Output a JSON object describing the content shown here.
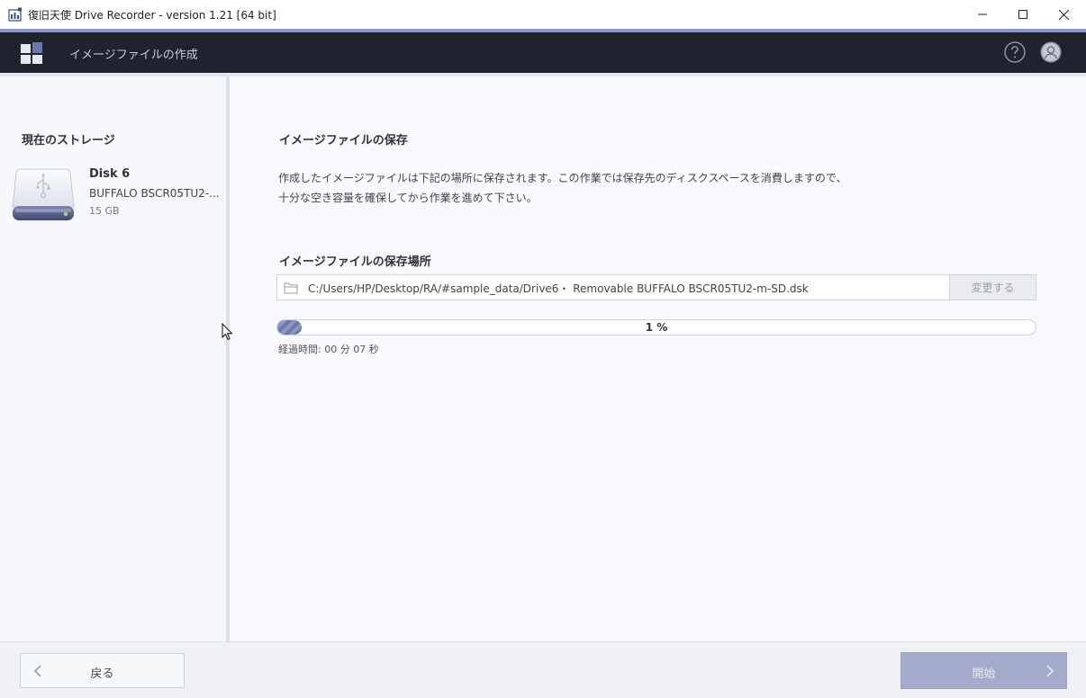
{
  "window": {
    "title": "復旧天使 Drive Recorder - version 1.21 [64 bit]"
  },
  "header": {
    "title": "イメージファイルの作成"
  },
  "sidebar": {
    "heading": "現在のストレージ",
    "disk": {
      "name": "Disk 6",
      "model": "BUFFALO BSCR05TU2-...",
      "size": "15 GB"
    }
  },
  "main": {
    "save_section_title": "イメージファイルの保存",
    "description_line1": "作成したイメージファイルは下記の場所に保存されます。この作業では保存先のディスクスペースを消費しますので、",
    "description_line2": "十分な空き容量を確保してから作業を進めて下さい。",
    "location_title": "イメージファイルの保存場所",
    "path": "C:/Users/HP/Desktop/RA/#sample_data/Drive6・ Removable BUFFALO BSCR05TU2-m-SD.dsk",
    "change_label": "変更する",
    "progress_percent": 1,
    "progress_label": "1 %",
    "elapsed": "経過時間: 00 分 07 秒"
  },
  "footer": {
    "back_label": "戻る",
    "start_label": "開始"
  },
  "colors": {
    "accent": "#8c95c9",
    "header_bg": "#20232e",
    "start_button": "#a5abcb",
    "progress_fill": "#6d78a8"
  },
  "icons": {
    "app": "app-icon",
    "minimize": "minimize-icon",
    "maximize": "maximize-icon",
    "close": "close-icon",
    "logo": "grid-logo-icon",
    "help": "help-icon",
    "user": "user-icon",
    "disk": "usb-drive-icon",
    "folder": "folder-icon",
    "back": "chevron-left-icon",
    "start": "chevron-right-icon"
  }
}
